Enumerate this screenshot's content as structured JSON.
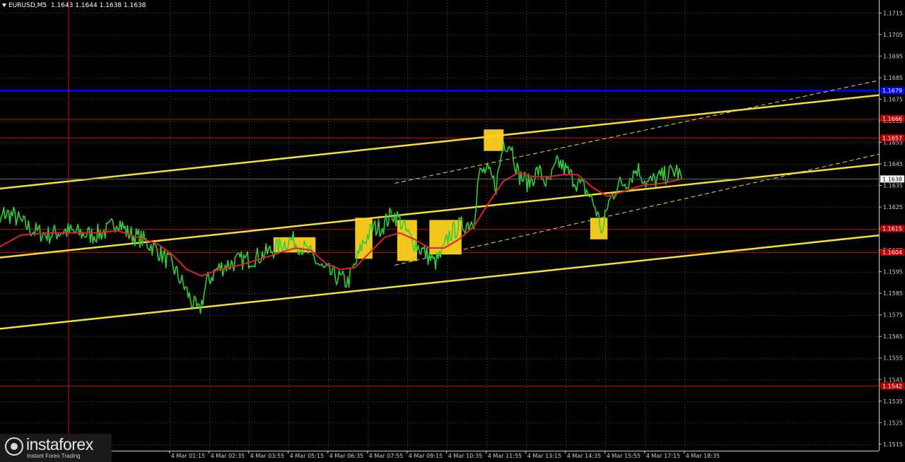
{
  "header": {
    "symbol": "EURUSD,M5",
    "ohlc": "1.1643 1.1644 1.1638 1.1638"
  },
  "logo": {
    "name": "instaforex",
    "tagline": "Instant Forex Trading"
  },
  "chart_data": {
    "type": "candlestick-line",
    "title": "EURUSD,M5",
    "yaxis": {
      "range": [
        1.1512,
        1.1721
      ],
      "ticks": [
        "1.1715",
        "1.1705",
        "1.1695",
        "1.1685",
        "1.1675",
        "1.1665",
        "1.1655",
        "1.1645",
        "1.1635",
        "1.1625",
        "1.1615",
        "1.1605",
        "1.1595",
        "1.1585",
        "1.1575",
        "1.1565",
        "1.1555",
        "1.1545",
        "1.1535",
        "1.1525",
        "1.1515"
      ]
    },
    "xaxis": {
      "ticks": [
        {
          "label": "4 Mar 01:15",
          "bar": 35
        },
        {
          "label": "4 Mar 02:35",
          "bar": 51
        },
        {
          "label": "4 Mar 03:55",
          "bar": 67
        },
        {
          "label": "4 Mar 05:15",
          "bar": 83
        },
        {
          "label": "4 Mar 06:35",
          "bar": 99
        },
        {
          "label": "4 Mar 07:55",
          "bar": 115
        },
        {
          "label": "4 Mar 09:15",
          "bar": 131
        },
        {
          "label": "4 Mar 10:35",
          "bar": 147
        },
        {
          "label": "4 Mar 11:55",
          "bar": 163
        },
        {
          "label": "4 Mar 13:15",
          "bar": 179
        },
        {
          "label": "4 Mar 14:35",
          "bar": 195
        },
        {
          "label": "4 Mar 15:55",
          "bar": 211
        },
        {
          "label": "4 Mar 17:15",
          "bar": 227
        },
        {
          "label": "4 Mar 18:35",
          "bar": 243
        }
      ]
    },
    "current_price": "1.1638",
    "horizontal_levels": [
      {
        "price": 1.1679,
        "label": "1.1679",
        "color": "#0000ff",
        "kind": "blue"
      },
      {
        "price": 1.1666,
        "label": "1.1666",
        "color": "#c00000",
        "kind": "red"
      },
      {
        "price": 1.1657,
        "label": "1.1657",
        "color": "#c00000",
        "kind": "red"
      },
      {
        "price": 1.1615,
        "label": "1.1615",
        "color": "#c00000",
        "kind": "red"
      },
      {
        "price": 1.1604,
        "label": "1.1604",
        "color": "#c00000",
        "kind": "red"
      },
      {
        "price": 1.1542,
        "label": "1.1542",
        "color": "#c00000",
        "kind": "red"
      }
    ],
    "vertical_markers": [
      {
        "bar": -6,
        "color": "#c00000"
      },
      {
        "bar": 326,
        "color": "#c00000"
      }
    ],
    "channel_lines": [
      {
        "bar1": -38,
        "price1": 1.1633,
        "bar2": 331,
        "price2": 1.1678,
        "style": "solid"
      },
      {
        "bar1": -38,
        "price1": 1.1601,
        "bar2": 331,
        "price2": 1.1646,
        "style": "solid"
      },
      {
        "bar1": -38,
        "price1": 1.1568,
        "bar2": 331,
        "price2": 1.1613,
        "style": "solid"
      },
      {
        "bar1": 126,
        "price1": 1.1636,
        "bar2": 331,
        "price2": 1.1686,
        "style": "dashed"
      },
      {
        "bar1": 126,
        "price1": 1.1598,
        "bar2": 331,
        "price2": 1.1652,
        "style": "dashed"
      }
    ],
    "signal_boxes": [
      {
        "bar1": 77,
        "bar2": 94,
        "p1": 1.1611,
        "p2": 1.1604
      },
      {
        "bar1": 110,
        "bar2": 117,
        "p1": 1.162,
        "p2": 1.1601
      },
      {
        "bar1": 127,
        "bar2": 135,
        "p1": 1.1619,
        "p2": 1.16
      },
      {
        "bar1": 140,
        "bar2": 153,
        "p1": 1.1619,
        "p2": 1.1603
      },
      {
        "bar1": 162,
        "bar2": 170,
        "p1": 1.1661,
        "p2": 1.1651
      },
      {
        "bar1": 205,
        "bar2": 212,
        "p1": 1.162,
        "p2": 1.161
      }
    ],
    "price_series_anchors": [
      [
        -38,
        1.1603
      ],
      [
        -34,
        1.1616
      ],
      [
        -32,
        1.1622
      ],
      [
        -28,
        1.1621
      ],
      [
        -25,
        1.1618
      ],
      [
        -20,
        1.1614
      ],
      [
        -14,
        1.1612
      ],
      [
        -8,
        1.1614
      ],
      [
        -2,
        1.1613
      ],
      [
        4,
        1.1612
      ],
      [
        10,
        1.1614
      ],
      [
        14,
        1.1619
      ],
      [
        18,
        1.1613
      ],
      [
        24,
        1.161
      ],
      [
        30,
        1.1605
      ],
      [
        36,
        1.1598
      ],
      [
        41,
        1.1588
      ],
      [
        44,
        1.1581
      ],
      [
        47,
        1.1576
      ],
      [
        50,
        1.159
      ],
      [
        54,
        1.1596
      ],
      [
        58,
        1.1598
      ],
      [
        63,
        1.16
      ],
      [
        68,
        1.1601
      ],
      [
        73,
        1.1603
      ],
      [
        80,
        1.1607
      ],
      [
        84,
        1.161
      ],
      [
        88,
        1.1607
      ],
      [
        92,
        1.1603
      ],
      [
        97,
        1.1596
      ],
      [
        102,
        1.1593
      ],
      [
        107,
        1.159
      ],
      [
        110,
        1.1598
      ],
      [
        113,
        1.1608
      ],
      [
        117,
        1.1615
      ],
      [
        121,
        1.1616
      ],
      [
        125,
        1.1622
      ],
      [
        128,
        1.1619
      ],
      [
        132,
        1.1611
      ],
      [
        136,
        1.1606
      ],
      [
        139,
        1.1603
      ],
      [
        142,
        1.1599
      ],
      [
        145,
        1.1603
      ],
      [
        148,
        1.1612
      ],
      [
        152,
        1.1616
      ],
      [
        155,
        1.1617
      ],
      [
        158,
        1.1619
      ],
      [
        160,
        1.164
      ],
      [
        163,
        1.1642
      ],
      [
        167,
        1.1635
      ],
      [
        170,
        1.1655
      ],
      [
        173,
        1.1654
      ],
      [
        176,
        1.164
      ],
      [
        180,
        1.1636
      ],
      [
        184,
        1.1642
      ],
      [
        188,
        1.1635
      ],
      [
        192,
        1.1646
      ],
      [
        196,
        1.1641
      ],
      [
        200,
        1.1636
      ],
      [
        204,
        1.1632
      ],
      [
        207,
        1.1625
      ],
      [
        210,
        1.1613
      ],
      [
        212,
        1.1626
      ],
      [
        216,
        1.1635
      ],
      [
        220,
        1.1637
      ],
      [
        224,
        1.1643
      ],
      [
        228,
        1.1636
      ],
      [
        232,
        1.1638
      ],
      [
        236,
        1.164
      ],
      [
        240,
        1.1642
      ],
      [
        242,
        1.1638
      ]
    ],
    "moving_average_anchors": [
      [
        -38,
        1.1602
      ],
      [
        -33,
        1.1607
      ],
      [
        -25,
        1.1612
      ],
      [
        -15,
        1.1613
      ],
      [
        -5,
        1.1613
      ],
      [
        5,
        1.1613
      ],
      [
        14,
        1.1614
      ],
      [
        22,
        1.1611
      ],
      [
        30,
        1.1608
      ],
      [
        36,
        1.1603
      ],
      [
        42,
        1.1596
      ],
      [
        48,
        1.1593
      ],
      [
        55,
        1.1596
      ],
      [
        63,
        1.1598
      ],
      [
        72,
        1.1601
      ],
      [
        80,
        1.1604
      ],
      [
        86,
        1.1606
      ],
      [
        92,
        1.1605
      ],
      [
        98,
        1.1599
      ],
      [
        104,
        1.1596
      ],
      [
        110,
        1.1597
      ],
      [
        116,
        1.1604
      ],
      [
        122,
        1.1611
      ],
      [
        128,
        1.1613
      ],
      [
        134,
        1.161
      ],
      [
        140,
        1.1606
      ],
      [
        146,
        1.1606
      ],
      [
        152,
        1.161
      ],
      [
        158,
        1.1616
      ],
      [
        164,
        1.1627
      ],
      [
        170,
        1.1637
      ],
      [
        176,
        1.1641
      ],
      [
        182,
        1.1639
      ],
      [
        188,
        1.1639
      ],
      [
        194,
        1.164
      ],
      [
        200,
        1.164
      ],
      [
        206,
        1.1634
      ],
      [
        212,
        1.163
      ],
      [
        218,
        1.1632
      ],
      [
        226,
        1.1635
      ],
      [
        234,
        1.1636
      ],
      [
        242,
        1.1638
      ]
    ]
  }
}
